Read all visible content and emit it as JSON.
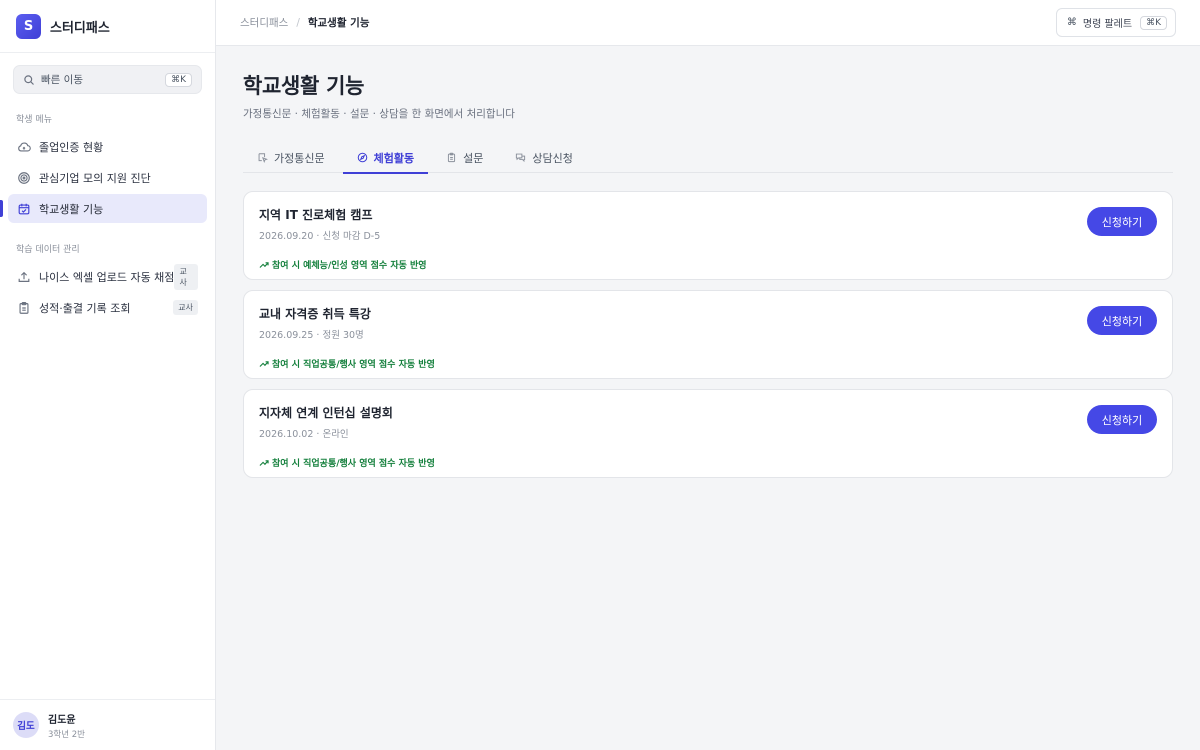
{
  "brand": {
    "logo_letter": "S",
    "name": "스터디패스"
  },
  "sidebar": {
    "quick_search": {
      "label": "빠른 이동",
      "shortcut": "⌘K"
    },
    "sections": [
      {
        "label": "학생 메뉴",
        "items": [
          {
            "label": "졸업인증 현황",
            "icon": "cloud-icon",
            "active": false
          },
          {
            "label": "관심기업 모의 지원 진단",
            "icon": "target-icon",
            "active": false
          },
          {
            "label": "학교생활 기능",
            "icon": "calendar-check-icon",
            "active": true
          }
        ]
      },
      {
        "label": "학습 데이터 관리",
        "items": [
          {
            "label": "나이스 엑셀 업로드 자동 채점",
            "icon": "upload-icon",
            "badge": "교사"
          },
          {
            "label": "성적·출결 기록 조회",
            "icon": "clipboard-icon",
            "badge": "교사"
          }
        ]
      }
    ],
    "user": {
      "initials": "김도",
      "name": "김도윤",
      "meta": "3학년 2반"
    }
  },
  "topbar": {
    "breadcrumb": [
      "스터디패스",
      "학교생활 기능"
    ],
    "breadcrumb_sep": "/",
    "palette": {
      "cmd_symbol": "⌘",
      "label": "명령 팔레트",
      "shortcut": "⌘K"
    }
  },
  "page": {
    "title": "학교생활 기능",
    "subtitle": "가정통신문 · 체험활동 · 설문 · 상담을 한 화면에서 처리합니다"
  },
  "tabs": [
    {
      "label": "가정통신문",
      "icon": "cursor-icon",
      "active": false
    },
    {
      "label": "체험활동",
      "icon": "compass-icon",
      "active": true
    },
    {
      "label": "설문",
      "icon": "clipboard-icon",
      "active": false
    },
    {
      "label": "상담신청",
      "icon": "chat-icon",
      "active": false
    }
  ],
  "activities": [
    {
      "title": "지역 IT 진로체험 캠프",
      "meta": "2026.09.20 · 신청 마감 D-5",
      "note": "참여 시 예체능/인성 영역 점수 자동 반영",
      "button": "신청하기"
    },
    {
      "title": "교내 자격증 취득 특강",
      "meta": "2026.09.25 · 정원 30명",
      "note": "참여 시 직업공통/행사 영역 점수 자동 반영",
      "button": "신청하기"
    },
    {
      "title": "지자체 연계 인턴십 설명회",
      "meta": "2026.10.02 · 온라인",
      "note": "참여 시 직업공통/행사 영역 점수 자동 반영",
      "button": "신청하기"
    }
  ],
  "colors": {
    "accent": "#3f3fd6",
    "button": "#4548e6",
    "success": "#15803d"
  }
}
